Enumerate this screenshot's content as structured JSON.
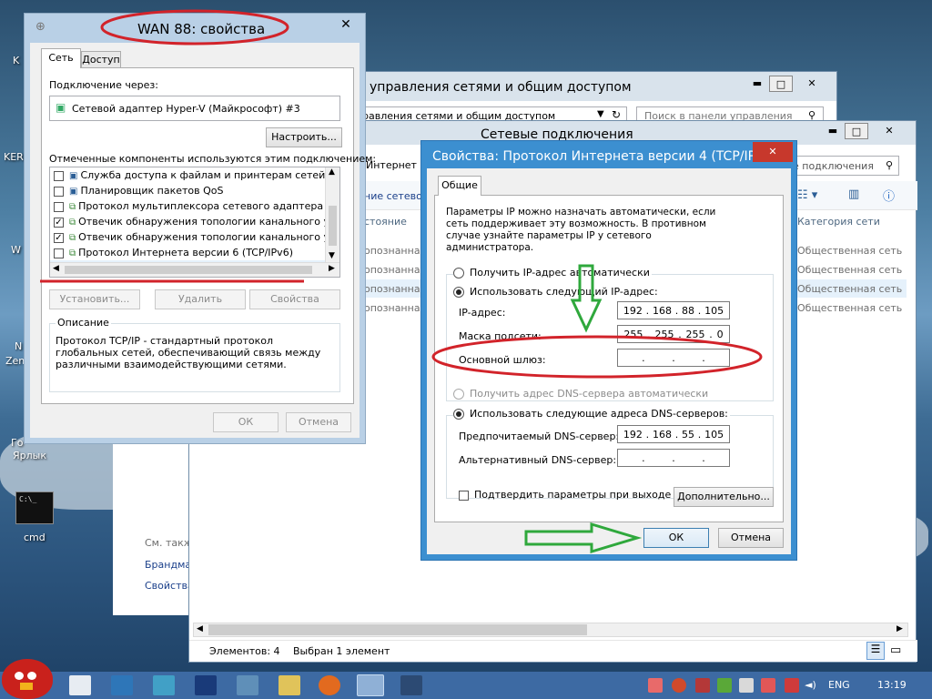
{
  "desktop": {
    "icon_k": "K",
    "icon_ker": "KER",
    "icon_w": "W",
    "icon_n": "N",
    "icon_zen": "Zen",
    "icon_label1": "Ярлык",
    "icon_label1b": "Го",
    "cmd_label": "cmd"
  },
  "back": {
    "title": "о управления сетями и общим доступом",
    "address": "равления сетями и общим доступом",
    "search_placeholder": "Поиск в панели управления",
    "see_also": "См. также",
    "link1": "Брандма",
    "link2": "Свойства"
  },
  "netconn": {
    "title": "Сетевые подключения",
    "search_placeholder": "е подключения",
    "internet": "Интернет",
    "netpart": "ние сетево",
    "col_status": "стояние",
    "col_category": "Категория сети",
    "rows": [
      {
        "status": "опознанная",
        "category": "Общественная сеть"
      },
      {
        "status": "опознанная",
        "category": "Общественная сеть"
      },
      {
        "status": "опознанная",
        "category": "Общественная сеть"
      },
      {
        "status": "опознанная",
        "category": "Общественная сеть"
      }
    ],
    "status_items": "Элементов: 4",
    "status_selected": "Выбран 1 элемент"
  },
  "wan": {
    "title": "WAN 88: свойства",
    "tabs": [
      "Сеть",
      "Доступ"
    ],
    "connect_via_label": "Подключение через:",
    "adapter": "Сетевой адаптер Hyper-V (Майкрософт) #3",
    "configure_btn": "Настроить...",
    "components_label": "Отмеченные компоненты используются этим подключением:",
    "components": [
      {
        "label": "Служба доступа к файлам и принтерам сетей Micro",
        "checked": false
      },
      {
        "label": "Планировщик пакетов QoS",
        "checked": false
      },
      {
        "label": "Протокол мультиплексора сетевого адаптера (Май",
        "checked": false
      },
      {
        "label": "Отвечик обнаружения топологии канального уров",
        "checked": true
      },
      {
        "label": "Отвечик обнаружения топологии канального уров",
        "checked": true
      },
      {
        "label": "Протокол Интернета версии 6 (TCP/IPv6)",
        "checked": false
      },
      {
        "label": "Протокол Интернета версии 4 (TCP/IPv4)",
        "checked": true
      }
    ],
    "install_btn": "Установить...",
    "remove_btn": "Удалить",
    "props_btn": "Свойства",
    "description_label": "Описание",
    "description": "Протокол TCP/IP - стандартный протокол глобальных сетей, обеспечивающий связь между различными взаимодействующими сетями.",
    "ok": "ОК",
    "cancel": "Отмена"
  },
  "ipv4": {
    "title": "Свойства: Протокол Интернета версии 4 (TCP/IPv4)",
    "tab": "Общие",
    "intro": "Параметры IP можно назначать автоматически, если сеть поддерживает эту возможность. В противном случае узнайте параметры IP у сетевого администратора.",
    "auto_ip": "Получить IP-адрес автоматически",
    "manual_ip": "Использовать следующий IP-адрес:",
    "ip_label": "IP-адрес:",
    "ip": [
      "192",
      "168",
      "88",
      "105"
    ],
    "mask_label": "Маска подсети:",
    "mask": [
      "255",
      "255",
      "255",
      "0"
    ],
    "gw_label": "Основной шлюз:",
    "gw": [
      "",
      "",
      "",
      ""
    ],
    "auto_dns": "Получить адрес DNS-сервера автоматически",
    "manual_dns": "Использовать следующие адреса DNS-серверов:",
    "dns1_label": "Предпочитаемый DNS-сервер:",
    "dns1": [
      "192",
      "168",
      "55",
      "105"
    ],
    "dns2_label": "Альтернативный DNS-сервер:",
    "dns2": [
      "",
      "",
      "",
      ""
    ],
    "validate": "Подтвердить параметры при выходе",
    "advanced_btn": "Дополнительно...",
    "ok": "ОК",
    "cancel": "Отмена"
  },
  "taskbar": {
    "lang": "ENG",
    "time": "13:19"
  },
  "colors": {
    "annotation_red": "#d2232a",
    "annotation_green": "#2fa83c",
    "title_accent": "#3c8fd0"
  }
}
